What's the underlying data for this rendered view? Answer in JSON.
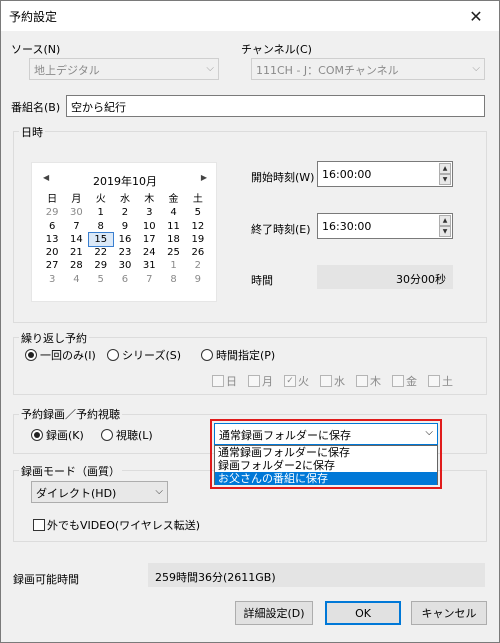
{
  "window": {
    "title": "予約設定",
    "close_glyph": "✕"
  },
  "source": {
    "label": "ソース(N)",
    "value": "地上デジタル"
  },
  "channel": {
    "label": "チャンネル(C)",
    "value": "111CH - J：COMチャンネル"
  },
  "program": {
    "label": "番組名(B)",
    "value": "空から紀行"
  },
  "datetime": {
    "group_title": "日時",
    "calendar": {
      "month_title": "2019年10月",
      "prev": "◀",
      "next": "▶",
      "weekdays": [
        "日",
        "月",
        "火",
        "水",
        "木",
        "金",
        "土"
      ],
      "weeks": [
        [
          "29",
          "30",
          "1",
          "2",
          "3",
          "4",
          "5"
        ],
        [
          "6",
          "7",
          "8",
          "9",
          "10",
          "11",
          "12"
        ],
        [
          "13",
          "14",
          "15",
          "16",
          "17",
          "18",
          "19"
        ],
        [
          "20",
          "21",
          "22",
          "23",
          "24",
          "25",
          "26"
        ],
        [
          "27",
          "28",
          "29",
          "30",
          "31",
          "1",
          "2"
        ],
        [
          "3",
          "4",
          "5",
          "6",
          "7",
          "8",
          "9"
        ]
      ]
    },
    "start_label": "開始時刻(W)",
    "start_value": "16:00:00",
    "end_label": "終了時刻(E)",
    "end_value": "16:30:00",
    "duration_label": "時間",
    "duration_value": "30分00秒",
    "spin_up": "▲",
    "spin_down": "▼"
  },
  "repeat": {
    "group_title": "繰り返し予約",
    "once": "一回のみ(I)",
    "series": "シリーズ(S)",
    "timed": "時間指定(P)",
    "days": [
      "日",
      "月",
      "火",
      "水",
      "木",
      "金",
      "土"
    ],
    "check_mark": "✓"
  },
  "record_view": {
    "group_title": "予約録画／予約視聴",
    "record": "録画(K)",
    "view": "視聴(L)",
    "folder_selected": "通常録画フォルダーに保存",
    "folder_options": [
      "通常録画フォルダーに保存",
      "録画フォルダー2に保存",
      "お父さんの番組に保存"
    ],
    "arrow": "⌵"
  },
  "record_mode": {
    "group_title": "録画モード（画質）",
    "value": "ダイレクト(HD)",
    "arrow": "⌵",
    "outside_video": "外でもVIDEO(ワイヤレス転送)"
  },
  "available": {
    "label": "録画可能時間",
    "value": "259時間36分(2611GB)"
  },
  "buttons": {
    "details": "詳細設定(D)",
    "ok": "OK",
    "cancel": "キャンセル"
  }
}
